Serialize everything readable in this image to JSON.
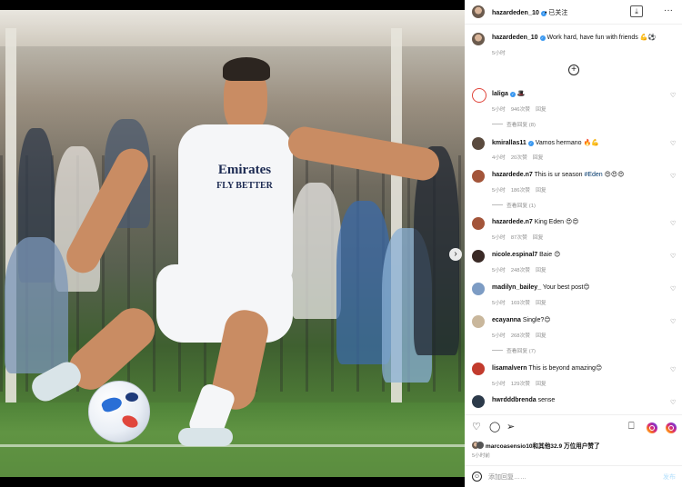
{
  "post": {
    "author": "hazardeden_10",
    "follow_status": "• 已关注",
    "caption": "Work hard, have fun with friends 💪⚽",
    "caption_time": "5小时"
  },
  "icons": {
    "download": "download-icon",
    "more": "more-icon",
    "add": "plus-circle-icon",
    "heart": "heart-icon",
    "comment": "comment-icon",
    "share": "send-icon",
    "save": "bookmark-icon",
    "emoji": "emoji-icon",
    "next": "chevron-right-icon"
  },
  "comments": [
    {
      "user": "laliga",
      "verified": true,
      "text": "🎩",
      "time": "5小时",
      "likes": "946次赞",
      "reply": "回复",
      "replies": "查看回复 (8)"
    },
    {
      "user": "kmirallas11",
      "verified": true,
      "text": "Vamos hermano 🔥💪",
      "time": "4小时",
      "likes": "20次赞",
      "reply": "回复",
      "replies": ""
    },
    {
      "user": "hazardede.n7",
      "verified": false,
      "text": "This is ur season ",
      "hashtag": "#Eden",
      "emoji": " 😍😍😍",
      "time": "5小时",
      "likes": "186次赞",
      "reply": "回复",
      "replies": "查看回复 (1)"
    },
    {
      "user": "hazardede.n7",
      "verified": false,
      "text": "King Eden 😍😍",
      "time": "5小时",
      "likes": "87次赞",
      "reply": "回复",
      "replies": ""
    },
    {
      "user": "nicole.espinal7",
      "verified": false,
      "text": "Baie 😊",
      "time": "5小时",
      "likes": "248次赞",
      "reply": "回复",
      "replies": ""
    },
    {
      "user": "madilyn_bailey_",
      "verified": false,
      "text": "Your best post😊",
      "time": "5小时",
      "likes": "169次赞",
      "reply": "回复",
      "replies": ""
    },
    {
      "user": "ecayanna",
      "verified": false,
      "text": "Single?😊",
      "time": "5小时",
      "likes": "268次赞",
      "reply": "回复",
      "replies": "查看回复 (7)"
    },
    {
      "user": "lisamalvern",
      "verified": false,
      "text": "This is beyond amazing😊",
      "time": "5小时",
      "likes": "129次赞",
      "reply": "回复",
      "replies": ""
    },
    {
      "user": "hwrdddbrenda",
      "verified": false,
      "text": "sense",
      "time": "",
      "likes": "",
      "reply": "",
      "replies": ""
    }
  ],
  "footer": {
    "liked_by": "marcoasensio10和其他32.9 万位用户赞了",
    "time": "5小时前",
    "comment_placeholder": "添加回复……",
    "post_label": "发布"
  },
  "colors": {
    "verified": "#3897f0",
    "link": "#00376b",
    "muted": "#8e8e8e",
    "post_disabled": "#b2dffc"
  }
}
